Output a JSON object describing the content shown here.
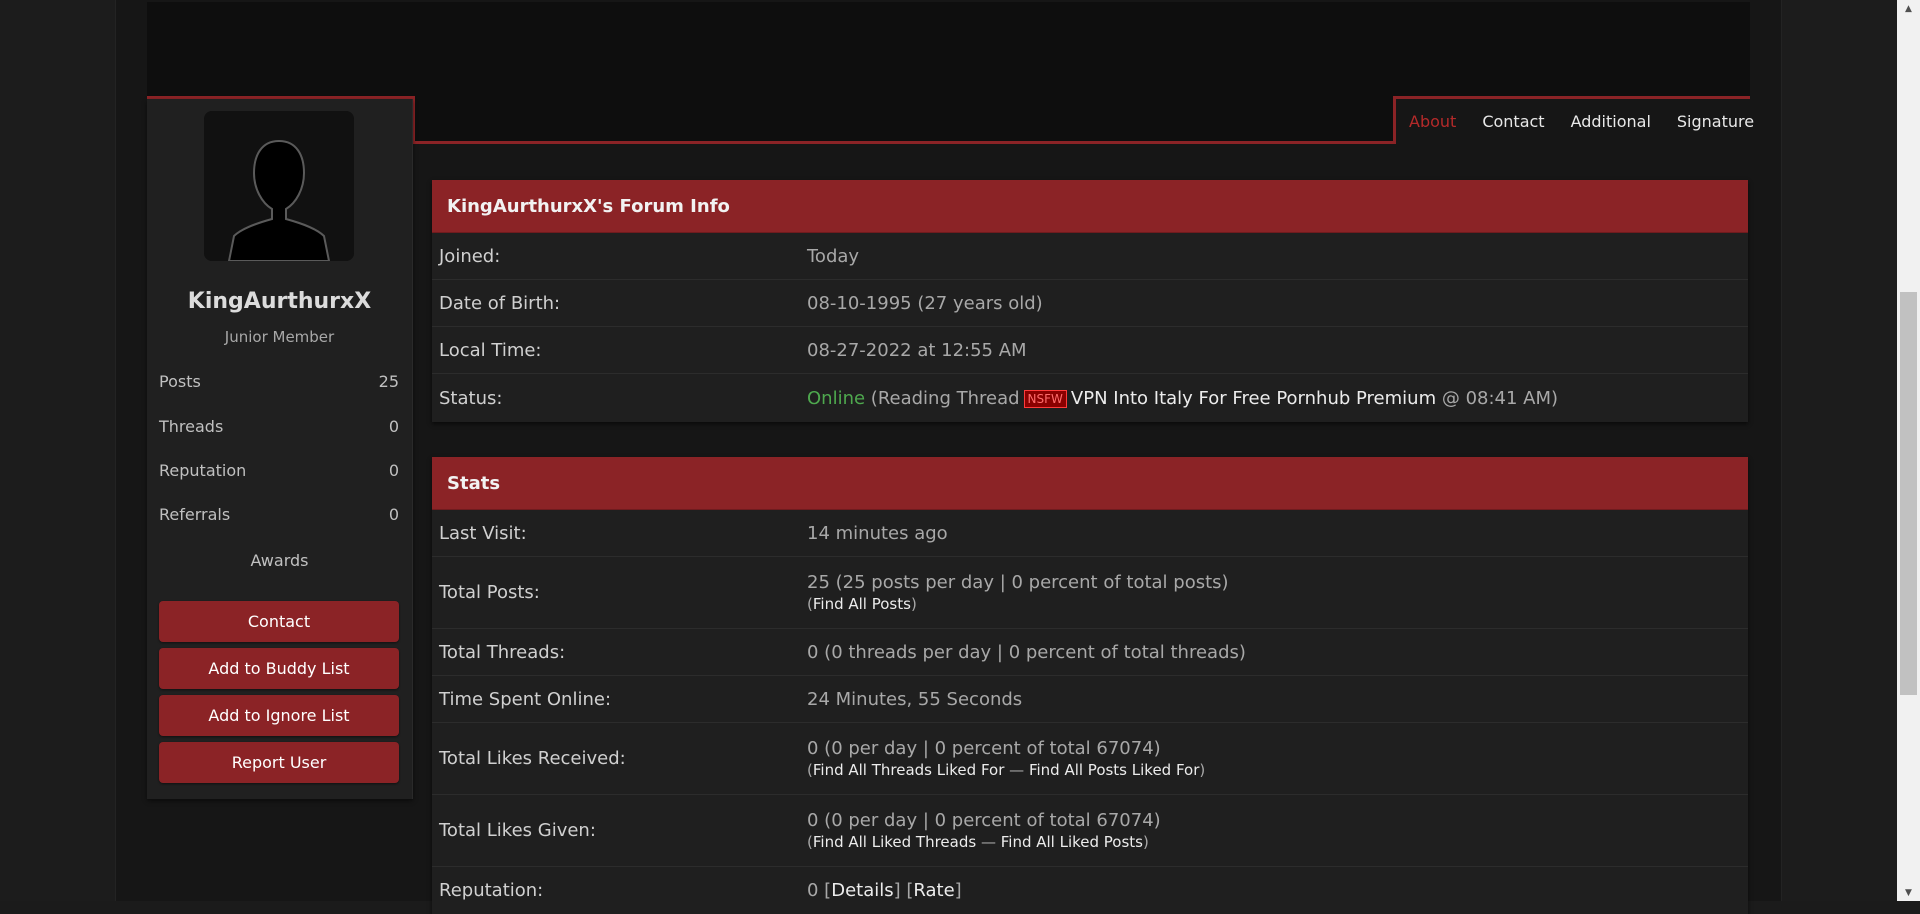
{
  "tabs": [
    {
      "label": "About"
    },
    {
      "label": "Contact"
    },
    {
      "label": "Additional"
    },
    {
      "label": "Signature"
    }
  ],
  "profile": {
    "username": "KingAurthurxX",
    "usertitle": "Junior Member",
    "stats": [
      {
        "label": "Posts",
        "value": "25"
      },
      {
        "label": "Threads",
        "value": "0"
      },
      {
        "label": "Reputation",
        "value": "0"
      },
      {
        "label": "Referrals",
        "value": "0"
      }
    ],
    "awards_label": "Awards",
    "buttons": [
      {
        "label": "Contact"
      },
      {
        "label": "Add to Buddy List"
      },
      {
        "label": "Add to Ignore List"
      },
      {
        "label": "Report User"
      }
    ]
  },
  "forum_info": {
    "title": "KingAurthurxX's Forum Info",
    "joined": {
      "label": "Joined:",
      "value": "Today"
    },
    "dob": {
      "label": "Date of Birth:",
      "value": "08-10-1995 (27 years old)"
    },
    "local_time": {
      "label": "Local Time:",
      "value": "08-27-2022 at 12:55 AM"
    },
    "status": {
      "label": "Status:",
      "online": "Online",
      "reading_prefix": "(Reading Thread",
      "nsfw_tag": "NSFW",
      "thread_title": "VPN Into Italy For Free Pornhub Premium",
      "time_suffix": "@ 08:41 AM)"
    }
  },
  "stats": {
    "title": "Stats",
    "last_visit": {
      "label": "Last Visit:",
      "value": "14 minutes ago"
    },
    "total_posts": {
      "label": "Total Posts:",
      "value": "25 (25 posts per day | 0 percent of total posts)",
      "open": "(",
      "link": "Find All Posts",
      "close": ")"
    },
    "total_threads": {
      "label": "Total Threads:",
      "value": "0 (0 threads per day | 0 percent of total threads)"
    },
    "time_online": {
      "label": "Time Spent Online:",
      "value": "24 Minutes, 55 Seconds"
    },
    "likes_received": {
      "label": "Total Likes Received:",
      "value": "0 (0 per day | 0 percent of total 67074)",
      "open": "(",
      "link1": "Find All Threads Liked For",
      "sep": " — ",
      "link2": "Find All Posts Liked For",
      "close": ")"
    },
    "likes_given": {
      "label": "Total Likes Given:",
      "value": "0 (0 per day | 0 percent of total 67074)",
      "open": "(",
      "link1": "Find All Liked Threads",
      "sep": " — ",
      "link2": "Find All Liked Posts",
      "close": ")"
    },
    "reputation": {
      "label": "Reputation:",
      "value": "0",
      "details": "Details",
      "rate": "Rate"
    }
  },
  "colors": {
    "accent": "#8b2326",
    "active_tab": "#b42a2a",
    "online": "#4ea84e"
  }
}
